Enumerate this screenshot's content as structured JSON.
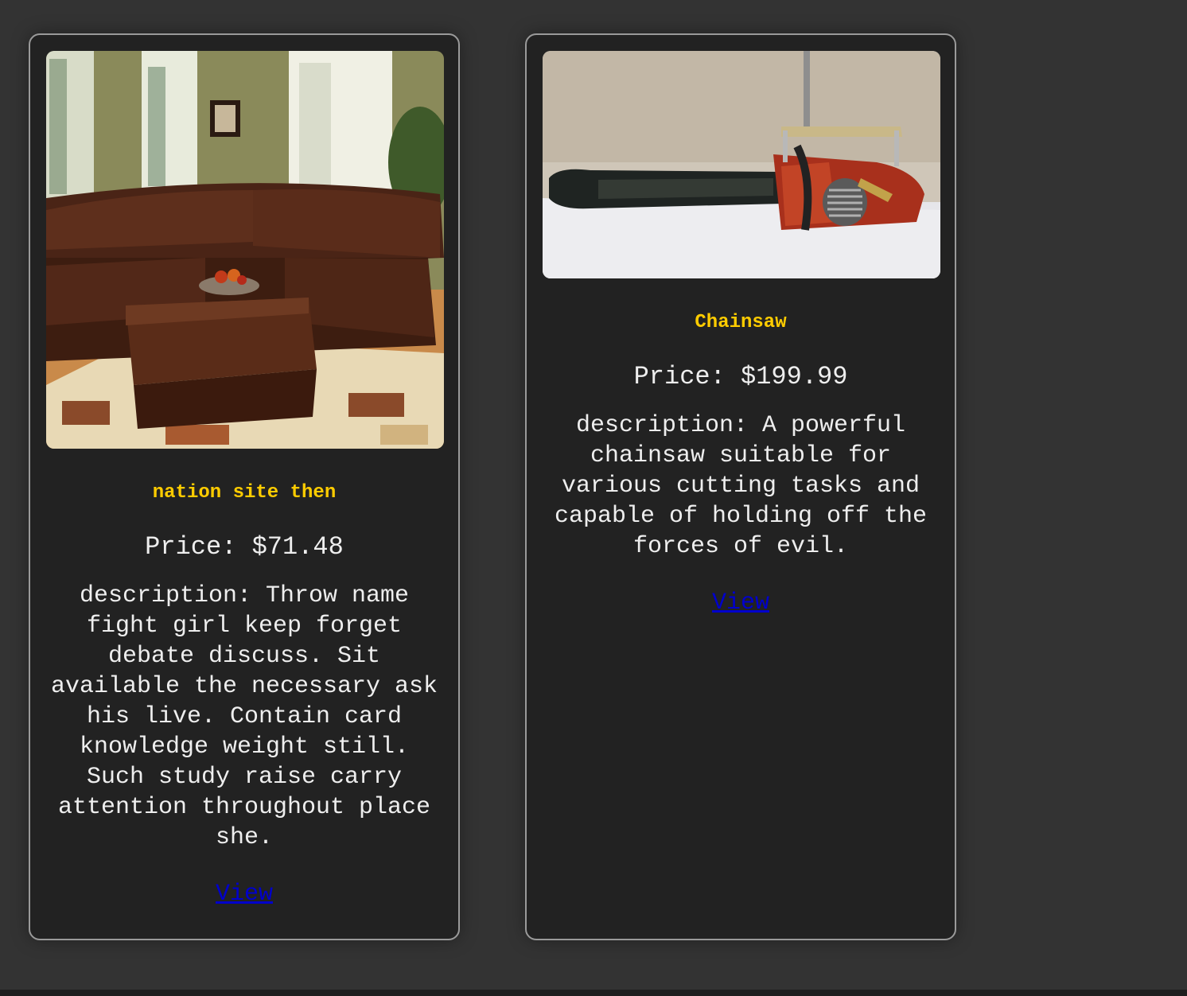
{
  "products": [
    {
      "image_alt": "brown leather sectional sofa with ottoman",
      "title": "nation site then",
      "price": "Price: $71.48",
      "description": "description: Throw name fight girl keep forget debate discuss. Sit available the necessary ask his live. Contain card knowledge weight still. Such study raise carry attention throughout place she.",
      "link_label": "View"
    },
    {
      "image_alt": "chainsaw",
      "title": "Chainsaw",
      "price": "Price: $199.99",
      "description": "description: A powerful chainsaw suitable for various cutting tasks and capable of holding off the forces of evil.",
      "link_label": "View"
    }
  ],
  "colors": {
    "page_background": "#333333",
    "card_background": "#222222",
    "card_border": "#9a9a9a",
    "title": "#ffcc00",
    "text": "#eeeeee",
    "link": "#0000cc"
  }
}
